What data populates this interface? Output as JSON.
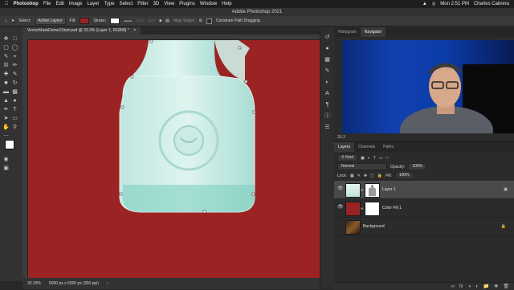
{
  "menubar": {
    "apple": "",
    "app_name": "Photoshop",
    "items": [
      "File",
      "Edit",
      "Image",
      "Layer",
      "Type",
      "Select",
      "Filter",
      "3D",
      "View",
      "Plugins",
      "Window",
      "Help"
    ],
    "clock": "Mon 2:51 PM",
    "user": "Charles Cabrera"
  },
  "window": {
    "title": "Adobe Photoshop 2021"
  },
  "options": {
    "select_label": "Select:",
    "select_value": "Active Layers",
    "fill_label": "Fill:",
    "stroke_label": "Stroke:",
    "align_edges": "Align Edges",
    "constrain_label": "Constrain Path Dragging",
    "fill_color": "#9b2323",
    "stroke_color": "#ffffff"
  },
  "document": {
    "tab": "VectorMaskDemo1Start.psd @ 33.3% (Layer 1, RGB/8) *",
    "zoom": "33.33%",
    "info": "6000 px x 6000 px (300 ppi)",
    "canvas_color": "#9b2323"
  },
  "navigator": {
    "tabs": [
      "Histogram",
      "Navigator"
    ],
    "active_tab": "Navigator",
    "zoom": "33.3"
  },
  "layers": {
    "tabs": [
      "Layers",
      "Channels",
      "Paths"
    ],
    "kind": "Kind",
    "blend_mode": "Normal",
    "opacity_label": "Opacity:",
    "opacity_value": "100%",
    "lock_label": "Lock:",
    "fill_label": "Fill:",
    "fill_value": "100%",
    "items": [
      {
        "name": "Layer 1"
      },
      {
        "name": "Color Fill 1"
      },
      {
        "name": "Background"
      }
    ]
  }
}
